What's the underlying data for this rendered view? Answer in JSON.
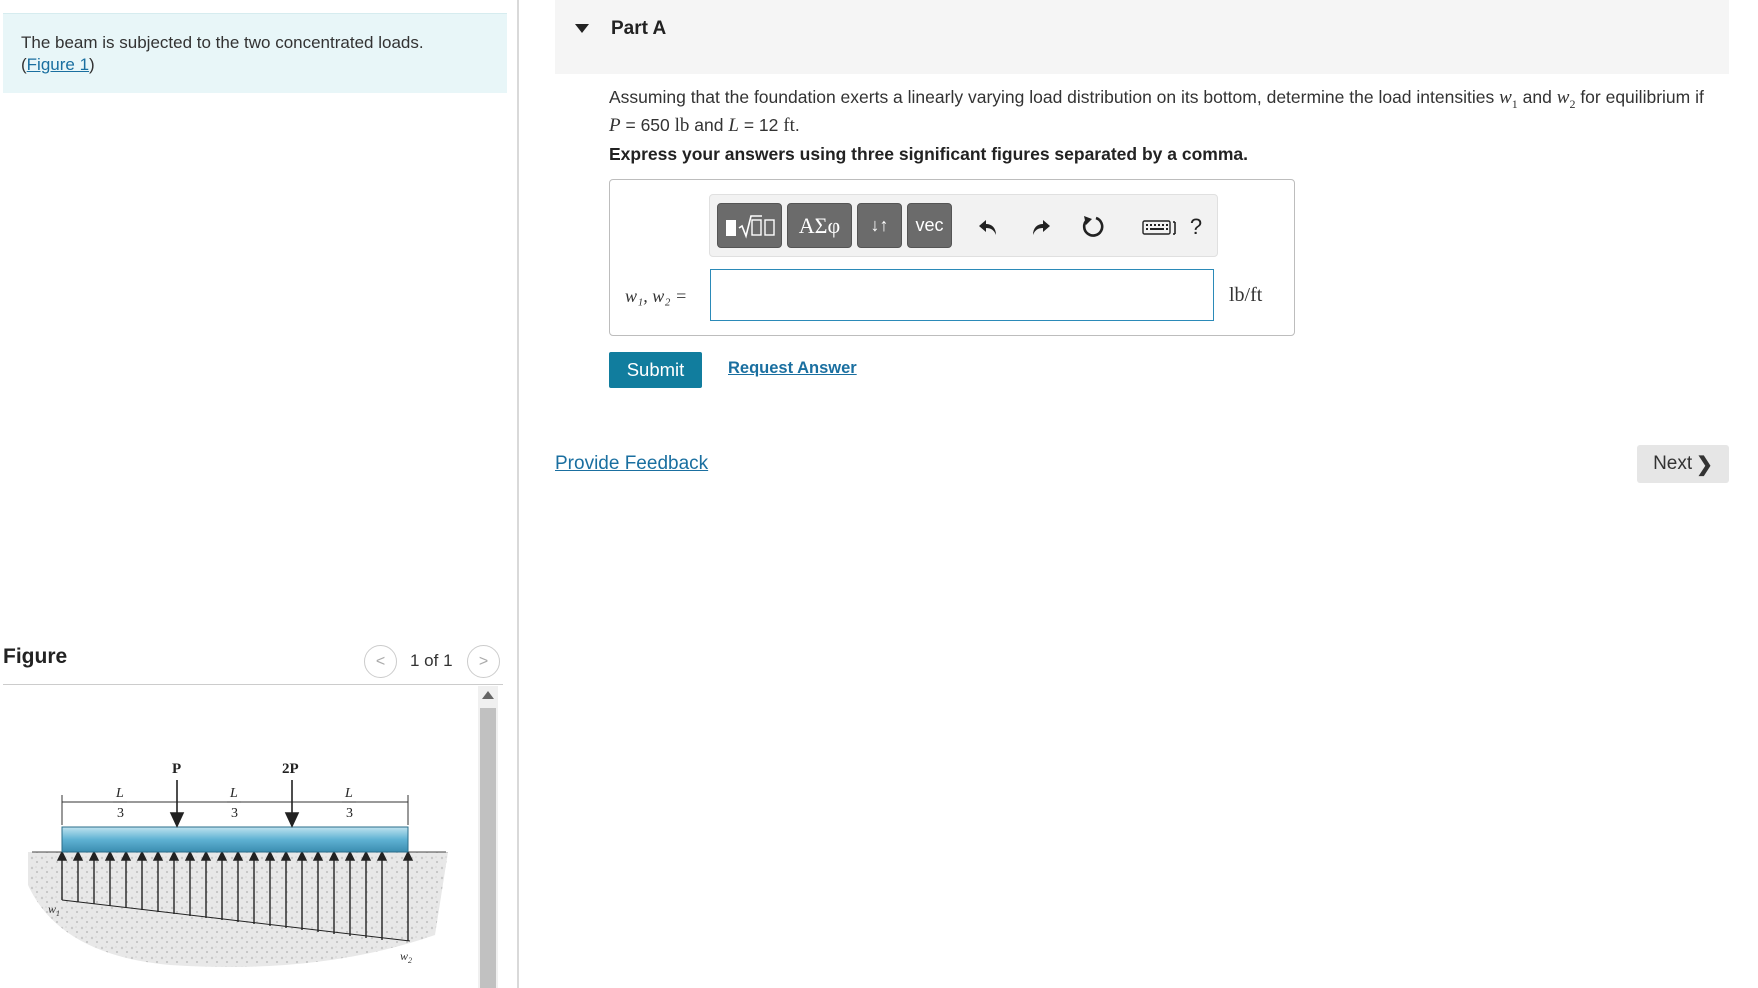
{
  "intro": {
    "text": "The beam is subjected to the two concentrated loads.",
    "figure_link_open": "(",
    "figure_link": "Figure 1",
    "figure_link_close": ")"
  },
  "figure_panel": {
    "title": "Figure",
    "page_indicator": "1 of 1",
    "prev_icon": "chevron-left-icon",
    "next_icon": "chevron-right-icon",
    "diagram": {
      "load_left": "P",
      "load_right": "2P",
      "span_label_num": "L",
      "span_label_den": "3",
      "w1_label": "w",
      "w1_sub": "1",
      "w2_label": "w",
      "w2_sub": "2"
    }
  },
  "part": {
    "title": "Part A",
    "caret_icon": "caret-down-icon"
  },
  "question": {
    "text_before": "Assuming that the foundation exerts a linearly varying load distribution on its bottom, determine the load intensities",
    "w1": "w",
    "w1_sub": "1",
    "and": "and",
    "w2": "w",
    "w2_sub": "2",
    "text_after": "for equilibrium if",
    "P_sym": "P",
    "P_eq": "= 650",
    "P_unit": "lb",
    "and2": "and",
    "L_sym": "L",
    "L_eq": "= 12",
    "L_unit": "ft",
    "period": "."
  },
  "instructions": "Express your answers using three significant figures separated by a comma.",
  "toolbar": {
    "greek_label": "ΑΣφ",
    "updown_label": "↓↑",
    "vec_label": "vec",
    "help_label": "?"
  },
  "answer": {
    "label": "w₁, w₂ =",
    "value": "",
    "unit": "lb/ft"
  },
  "buttons": {
    "submit": "Submit",
    "request_answer": "Request Answer",
    "provide_feedback": "Provide Feedback",
    "next": "Next",
    "next_chevron": "❯"
  }
}
